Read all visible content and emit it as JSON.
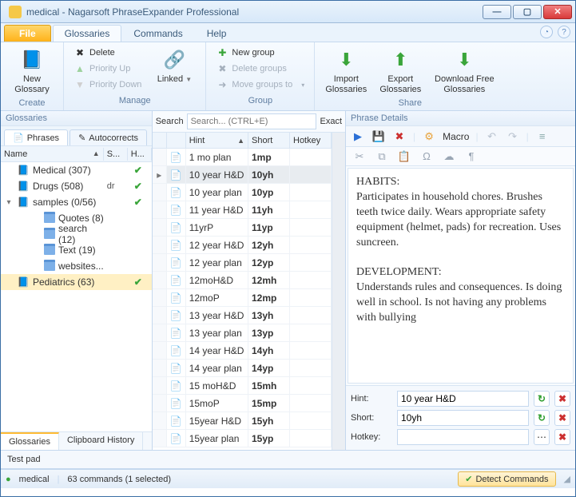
{
  "window": {
    "title": "medical - Nagarsoft PhraseExpander Professional"
  },
  "menu_tabs": {
    "file": "File",
    "glossaries": "Glossaries",
    "commands": "Commands",
    "help": "Help"
  },
  "ribbon": {
    "create": {
      "label": "Create",
      "new_glossary": "New Glossary"
    },
    "manage": {
      "label": "Manage",
      "delete": "Delete",
      "priority_up": "Priority Up",
      "priority_down": "Priority Down",
      "linked": "Linked"
    },
    "group": {
      "label": "Group",
      "new_group": "New group",
      "delete_groups": "Delete groups",
      "move_groups": "Move groups to"
    },
    "share": {
      "label": "Share",
      "import": "Import Glossaries",
      "export": "Export Glossaries",
      "download": "Download Free Glossaries"
    }
  },
  "left": {
    "header": "Glossaries",
    "tabs": {
      "phrases": "Phrases",
      "autocorrects": "Autocorrects"
    },
    "columns": {
      "name": "Name",
      "s": "S...",
      "h": "H..."
    },
    "tree": [
      {
        "indent": 0,
        "exp": "",
        "icon": "book",
        "label": "Medical (307)",
        "extra": "",
        "check": true
      },
      {
        "indent": 0,
        "exp": "",
        "icon": "book",
        "label": "Drugs (508)",
        "extra": "dr",
        "check": true
      },
      {
        "indent": 0,
        "exp": "v",
        "icon": "book",
        "label": "samples (0/56)",
        "extra": "",
        "check": true
      },
      {
        "indent": 1,
        "exp": "",
        "icon": "folder",
        "label": "Quotes (8)",
        "extra": "",
        "check": false
      },
      {
        "indent": 1,
        "exp": "",
        "icon": "folder",
        "label": "search (12)",
        "extra": "",
        "check": false
      },
      {
        "indent": 1,
        "exp": "",
        "icon": "folder",
        "label": "Text (19)",
        "extra": "",
        "check": false
      },
      {
        "indent": 1,
        "exp": "",
        "icon": "folder",
        "label": "websites...",
        "extra": "",
        "check": false
      },
      {
        "indent": 0,
        "exp": "",
        "icon": "book",
        "label": "Pediatrics (63)",
        "extra": "",
        "check": true,
        "selected": true
      }
    ],
    "bottom_tabs": {
      "glossaries": "Glossaries",
      "clipboard": "Clipboard History"
    }
  },
  "mid": {
    "search_label": "Search",
    "search_placeholder": "Search... (CTRL+E)",
    "exact": "Exact",
    "columns": {
      "hint": "Hint",
      "short": "Short",
      "hotkey": "Hotkey"
    },
    "rows": [
      {
        "hint": "1 mo plan",
        "short": "1mp"
      },
      {
        "hint": "10 year H&D",
        "short": "10yh",
        "selected": true
      },
      {
        "hint": "10 year plan",
        "short": "10yp"
      },
      {
        "hint": "11 year H&D",
        "short": "11yh"
      },
      {
        "hint": "11yrP",
        "short": "11yp"
      },
      {
        "hint": "12 year H&D",
        "short": "12yh"
      },
      {
        "hint": "12 year plan",
        "short": "12yp"
      },
      {
        "hint": "12moH&D",
        "short": "12mh"
      },
      {
        "hint": "12moP",
        "short": "12mp"
      },
      {
        "hint": "13 year H&D",
        "short": "13yh"
      },
      {
        "hint": "13 year plan",
        "short": "13yp"
      },
      {
        "hint": "14 year H&D",
        "short": "14yh"
      },
      {
        "hint": "14 year plan",
        "short": "14yp"
      },
      {
        "hint": "15 moH&D",
        "short": "15mh"
      },
      {
        "hint": "15moP",
        "short": "15mp"
      },
      {
        "hint": "15year H&D",
        "short": "15yh"
      },
      {
        "hint": "15year plan",
        "short": "15yp"
      }
    ]
  },
  "right": {
    "header": "Phrase Details",
    "macro": "Macro",
    "body_h1": "HABITS:",
    "body_p1": "Participates in household chores.  Brushes teeth twice daily.  Wears appropriate safety equipment (helmet, pads) for recreation.  Uses suncreen.",
    "body_h2": "DEVELOPMENT:",
    "body_p2": "Understands rules and consequences.  Is doing well in school.  Is not having any problems with bullying",
    "fields": {
      "hint_label": "Hint:",
      "hint_value": "10 year H&D",
      "short_label": "Short:",
      "short_value": "10yh",
      "hotkey_label": "Hotkey:",
      "hotkey_value": ""
    }
  },
  "testpad": "Test pad",
  "status": {
    "glossary": "medical",
    "summary": "63 commands (1 selected)",
    "detect": "Detect Commands"
  }
}
